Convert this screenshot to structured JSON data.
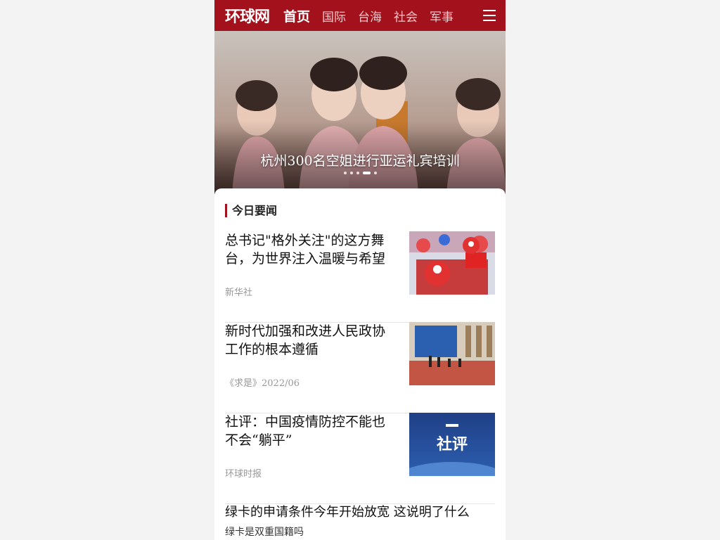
{
  "header": {
    "logo": "环球网",
    "nav": [
      "首页",
      "国际",
      "台海",
      "社会",
      "军事"
    ]
  },
  "banner": {
    "caption": "杭州300名空姐进行亚运礼宾培训",
    "slide_count": 5,
    "active_slide": 4
  },
  "section": {
    "title": "今日要闻"
  },
  "news": [
    {
      "title": "总书记\"格外关注\"的这方舞台，为世界注入温暖与希望",
      "source": "新华社"
    },
    {
      "title": "新时代加强和改进人民政协工作的根本遵循",
      "source": "《求是》2022/06"
    },
    {
      "title": "社评：中国疫情防控不能也不会“躺平”",
      "source": "环球时报",
      "thumb_text": "社评"
    }
  ],
  "text_news": {
    "title": "绿卡的申请条件今年开始放宽 这说明了什么",
    "subtitle": "绿卡是双重国籍吗"
  },
  "colors": {
    "brand": "#a3121c"
  }
}
